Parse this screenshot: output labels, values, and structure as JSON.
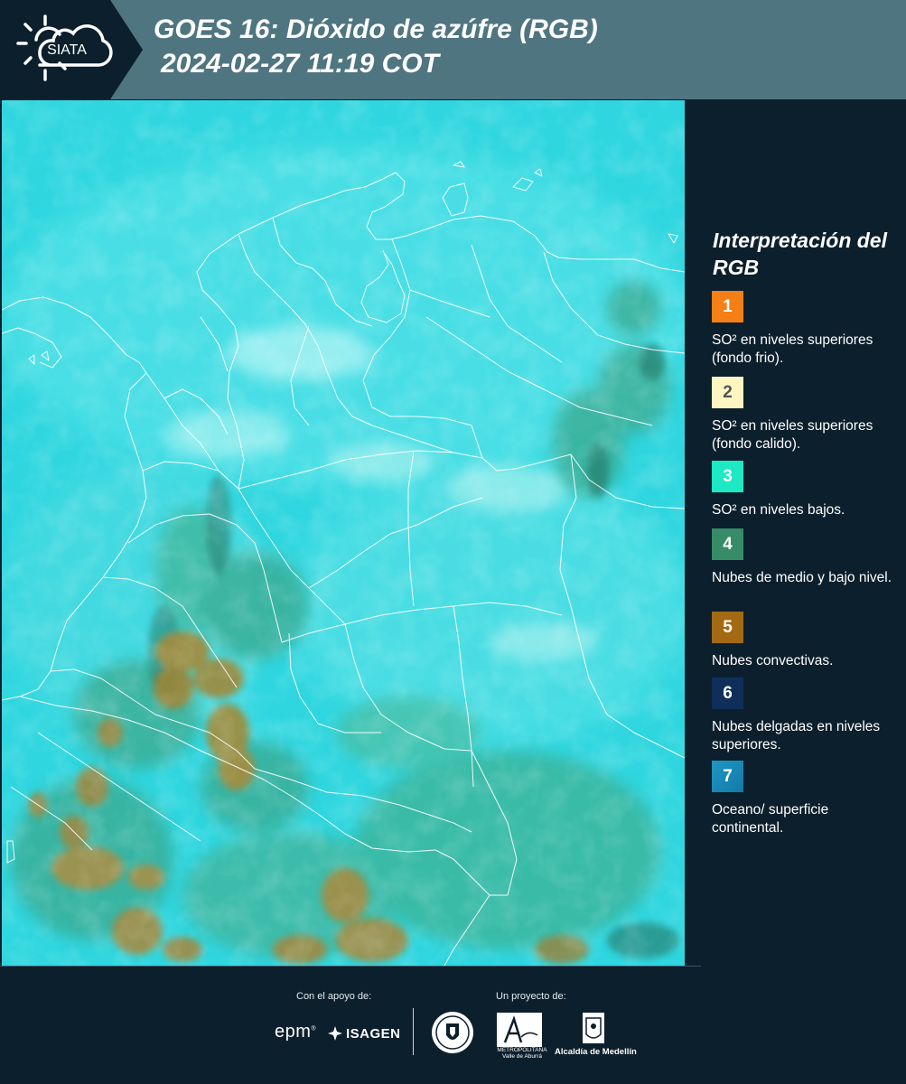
{
  "header": {
    "logo_text": "SIATA",
    "title_line1": "GOES 16: Dióxido de azúfre (RGB)",
    "title_line2": "2024-02-27 11:19 COT"
  },
  "colors": {
    "background": "#0c1f2c",
    "header_band": "#4f7580",
    "map_base": "#2fd6df",
    "borders": "#ffffff"
  },
  "legend": {
    "title": "Interpretación del RGB",
    "items": [
      {
        "number": "1",
        "color": "#f57f17",
        "text_color": "#ffffff",
        "label": "SO² en niveles superiores (fondo frio)."
      },
      {
        "number": "2",
        "color": "#fdf6c3",
        "text_color": "#555555",
        "label": "SO² en niveles superiores (fondo calido)."
      },
      {
        "number": "3",
        "color": "#1de9c4",
        "text_color": "#ffffff",
        "label": "SO² en niveles bajos."
      },
      {
        "number": "4",
        "color": "#358c66",
        "text_color": "#ffffff",
        "label": "Nubes de medio y bajo nivel."
      },
      {
        "number": "5",
        "color": "#a36a13",
        "text_color": "#ffffff",
        "label": "Nubes convectivas."
      },
      {
        "number": "6",
        "color": "#0f2f5a",
        "text_color": "#ffffff",
        "label": "Nubes delgadas en niveles superiores."
      },
      {
        "number": "7",
        "color": "#1e98c6",
        "text_color": "#ffffff",
        "label": "Oceano/ superficie continental."
      }
    ]
  },
  "footer": {
    "support_caption": "Con el apoyo de:",
    "project_caption": "Un proyecto de:",
    "epm": "epm",
    "isagen": "ISAGEN",
    "area_sub": "METROPOLITANA Valle de Aburrá",
    "alcaldia": "Alcaldía de Medellín"
  }
}
